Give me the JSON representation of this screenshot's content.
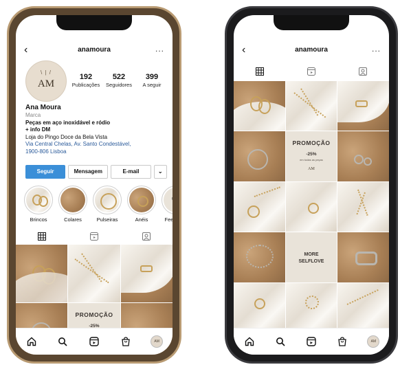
{
  "left_phone": {
    "header": {
      "username": "anamoura",
      "more": "..."
    },
    "avatar": {
      "monogram": "AM"
    },
    "stats": [
      {
        "value": "192",
        "label": "Publicações"
      },
      {
        "value": "522",
        "label": "Seguidores"
      },
      {
        "value": "399",
        "label": "A seguir"
      }
    ],
    "bio": {
      "name": "Ana Moura",
      "category": "Marca",
      "line1": "Peças em aço inoxidável e ródio",
      "line2": "+ info DM",
      "line3": "Loja do Pingo Doce da Bela Vista",
      "address1": "Via Central Chelas, Av. Santo Condestável,",
      "address2": "1900-806 Lisboa"
    },
    "buttons": {
      "follow": "Seguir",
      "message": "Mensagem",
      "email": "E-mail",
      "dropdown": "⌄"
    },
    "highlights": [
      {
        "label": "Brincos"
      },
      {
        "label": "Colares"
      },
      {
        "label": "Pulseiras"
      },
      {
        "label": "Anéis"
      },
      {
        "label": "Feedback",
        "thumb_text": "feedb"
      }
    ],
    "grid_promo": {
      "title": "PROMOÇÃO",
      "pct": "-25%",
      "note": "em todas as peças"
    }
  },
  "right_phone": {
    "header": {
      "username": "anamoura",
      "more": "..."
    },
    "grid_promo": {
      "title": "PROMOÇÃO",
      "pct": "-25%",
      "note": "em todas as peças",
      "logo": "AM"
    },
    "grid_text": {
      "line1": "MORE",
      "line2": "SELFLOVE"
    }
  },
  "nav": {
    "avatar_text": "AM"
  },
  "colors": {
    "follow_blue": "#3b8fd8",
    "gold": "#c7a15a",
    "sand": "#b8936a",
    "cream": "#e9e3d9"
  },
  "icons": [
    "back-arrow-icon",
    "more-dots-icon",
    "grid-icon",
    "reels-icon",
    "tagged-icon",
    "home-icon",
    "search-icon",
    "reels-nav-icon",
    "shop-icon"
  ]
}
